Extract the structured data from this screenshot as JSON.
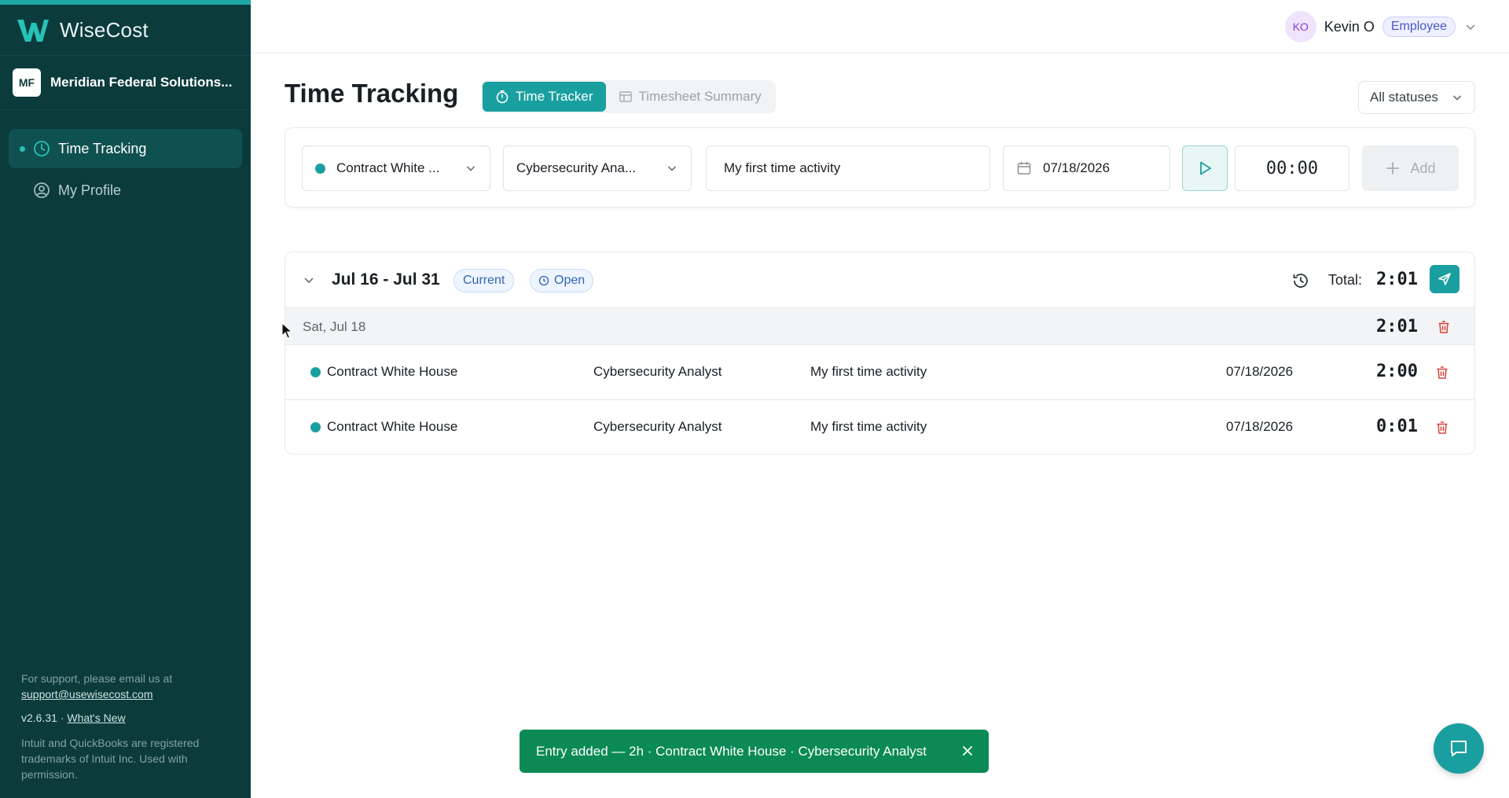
{
  "brand": {
    "name": "WiseCost"
  },
  "org": {
    "initials": "MF",
    "name": "Meridian Federal Solutions..."
  },
  "nav": {
    "items": [
      {
        "label": "Time Tracking",
        "active": true
      },
      {
        "label": "My Profile",
        "active": false
      }
    ]
  },
  "footer": {
    "support_text": "For support, please email us at",
    "support_email": "support@usewisecost.com",
    "version": "v2.6.31 ·",
    "whats_new": "What's New",
    "trademark": "Intuit and QuickBooks are registered trademarks of Intuit Inc. Used with permission."
  },
  "header": {
    "user_initials": "KO",
    "user_name": "Kevin O",
    "role": "Employee"
  },
  "page": {
    "title": "Time Tracking",
    "tabs": [
      {
        "label": "Time Tracker",
        "active": true,
        "icon": "stopwatch-icon"
      },
      {
        "label": "Timesheet Summary",
        "active": false,
        "icon": "table-icon"
      }
    ],
    "status_filter": "All statuses"
  },
  "entry_form": {
    "contract": "Contract White ...",
    "role": "Cybersecurity Ana...",
    "description": "My first time activity",
    "date": "07/18/2026",
    "timer": "00:00",
    "add_label": "Add"
  },
  "period": {
    "range": "Jul 16 - Jul 31",
    "current_badge": "Current",
    "status_badge": "Open",
    "total_label": "Total:",
    "total_value": "2:01",
    "days": [
      {
        "label": "Sat, Jul 18",
        "total": "2:01",
        "entries": [
          {
            "contract": "Contract White House",
            "role": "Cybersecurity Analyst",
            "description": "My first time activity",
            "date": "07/18/2026",
            "duration": "2:00"
          },
          {
            "contract": "Contract White House",
            "role": "Cybersecurity Analyst",
            "description": "My first time activity",
            "date": "07/18/2026",
            "duration": "0:01"
          }
        ]
      }
    ]
  },
  "toast": {
    "message": "Entry added — 2h · Contract White House · Cybersecurity Analyst"
  },
  "colors": {
    "sidebar": "#0c3b3c",
    "accent": "#1a9fa0",
    "toast": "#0b8a55",
    "danger": "#d9453b"
  }
}
